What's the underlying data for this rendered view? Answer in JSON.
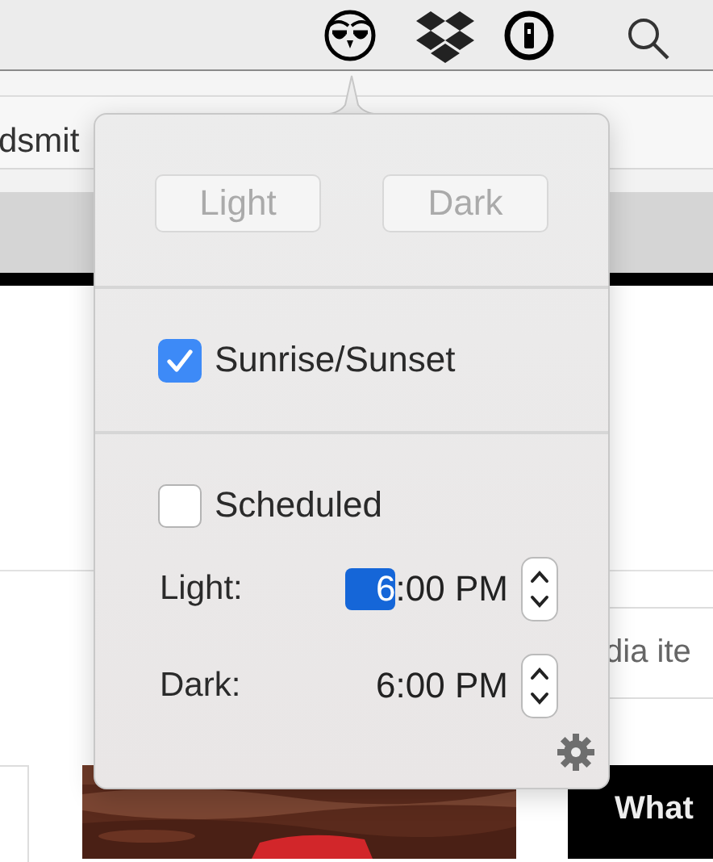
{
  "browser": {
    "address_text": "dsmit"
  },
  "page": {
    "side_text": "dia ite",
    "banner_text": "What"
  },
  "popover": {
    "mode_buttons": [
      {
        "label": "Light",
        "disabled": true
      },
      {
        "label": "Dark",
        "disabled": true
      }
    ],
    "options": [
      {
        "label": "Sunrise/Sunset",
        "checked": true
      },
      {
        "label": "Scheduled",
        "checked": false
      }
    ],
    "times": [
      {
        "label": "Light:",
        "hour": "6",
        "rest": ":00 PM",
        "focused": true
      },
      {
        "label": "Dark:",
        "hour": "6",
        "rest": ":00 PM",
        "focused": false
      }
    ]
  }
}
